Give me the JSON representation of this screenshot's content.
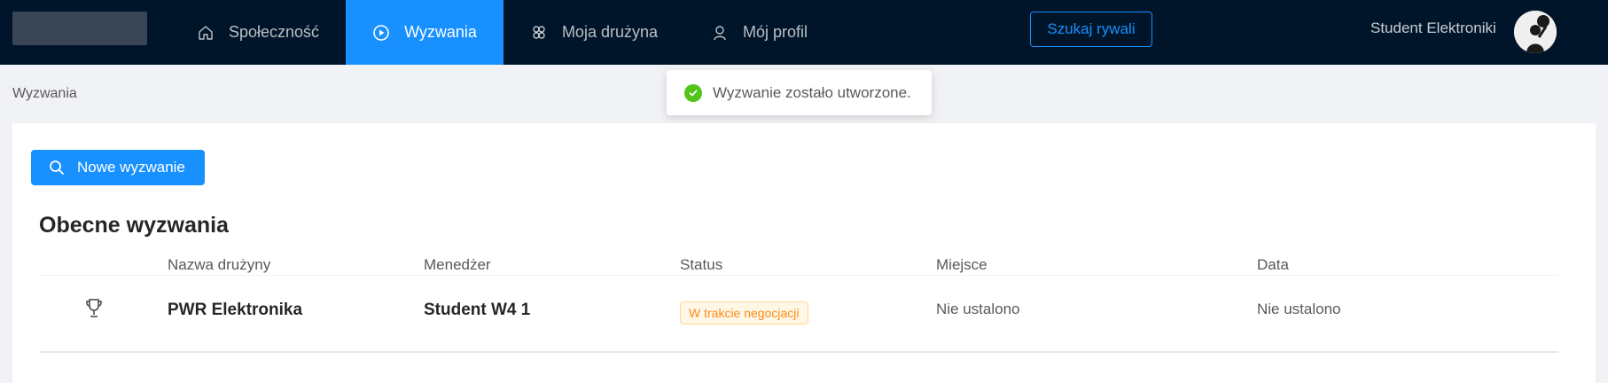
{
  "nav": {
    "items": [
      {
        "label": "Społeczność",
        "icon": "home-icon"
      },
      {
        "label": "Wyzwania",
        "icon": "play-circle-icon",
        "active": true
      },
      {
        "label": "Moja drużyna",
        "icon": "team-icon"
      },
      {
        "label": "Mój profil",
        "icon": "user-icon"
      }
    ],
    "search_button": "Szukaj rywali",
    "username": "Student Elektroniki"
  },
  "toast": {
    "message": "Wyzwanie zostało utworzone.",
    "icon": "check-circle-icon"
  },
  "breadcrumb": "Wyzwania",
  "main": {
    "new_button": "Nowe wyzwanie",
    "section_title": "Obecne wyzwania",
    "columns": [
      "Nazwa drużyny",
      "Menedżer",
      "Status",
      "Miejsce",
      "Data"
    ],
    "rows": [
      {
        "icon": "trophy-icon",
        "team": "PWR Elektronika",
        "manager": "Student W4 1",
        "status": "W trakcie negocjacji",
        "place": "Nie ustalono",
        "date": "Nie ustalono"
      }
    ]
  },
  "colors": {
    "topbar": "#001529",
    "accent": "#1890ff",
    "success": "#52c41a",
    "warning": "#fa8c16"
  }
}
